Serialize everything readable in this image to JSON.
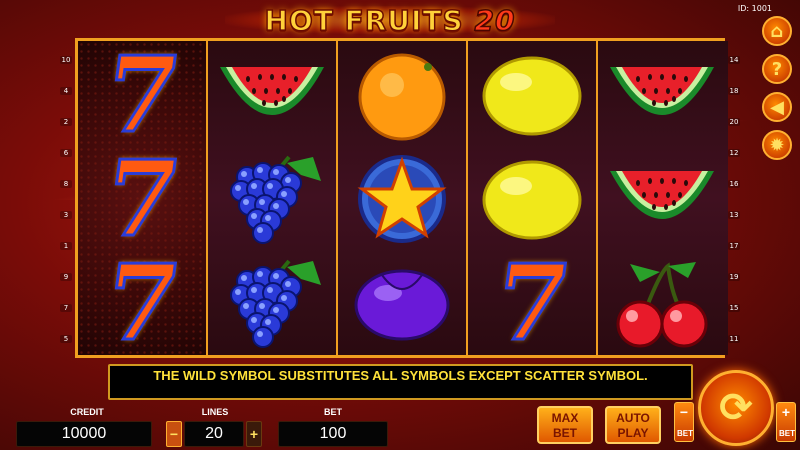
{
  "title": {
    "main": "HOT FRUITS",
    "num": "20"
  },
  "game_id": "ID: 1001",
  "left_lines": [
    "10",
    "4",
    "2",
    "6",
    "8",
    "3",
    "1",
    "9",
    "7",
    "5"
  ],
  "right_lines": [
    "14",
    "18",
    "20",
    "12",
    "16",
    "13",
    "17",
    "19",
    "15",
    "11"
  ],
  "reels": [
    [
      "seven",
      "seven",
      "seven"
    ],
    [
      "watermelon",
      "grapes",
      "grapes"
    ],
    [
      "orange",
      "star",
      "plum"
    ],
    [
      "lemon",
      "lemon",
      "seven"
    ],
    [
      "watermelon",
      "watermelon",
      "cherries"
    ]
  ],
  "side_buttons": [
    {
      "name": "home-icon",
      "glyph": "⌂"
    },
    {
      "name": "help-icon",
      "glyph": "?"
    },
    {
      "name": "sound-icon",
      "glyph": "◀"
    },
    {
      "name": "settings-icon",
      "glyph": "✹"
    }
  ],
  "info_text": "THE WILD SYMBOL SUBSTITUTES ALL SYMBOLS EXCEPT SCATTER SYMBOL.",
  "credit": {
    "label": "CREDIT",
    "value": "10000"
  },
  "lines": {
    "label": "LINES",
    "value": "20",
    "minus": "−",
    "plus": "+"
  },
  "bet": {
    "label": "BET",
    "value": "100"
  },
  "max_bet": {
    "line1": "MAX",
    "line2": "BET"
  },
  "auto_play": {
    "line1": "AUTO",
    "line2": "PLAY"
  },
  "bet_minus": {
    "sym": "−",
    "label": "BET"
  },
  "bet_plus": {
    "sym": "+",
    "label": "BET"
  },
  "spin_glyph": "⟳",
  "colors": {
    "frame": "#f0a020",
    "info_text": "#ffe23a",
    "button": "#e05800"
  }
}
